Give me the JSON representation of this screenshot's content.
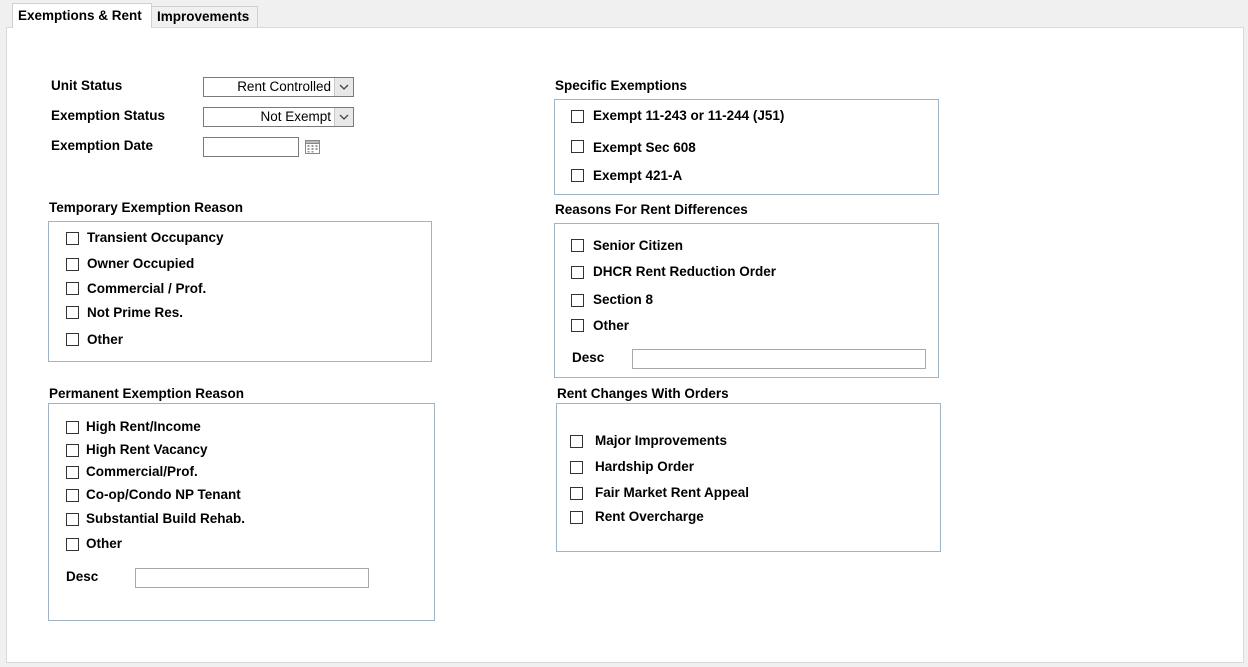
{
  "tabs": [
    {
      "label": "Exemptions & Rent",
      "active": true
    },
    {
      "label": "Improvements",
      "active": false
    }
  ],
  "fields": {
    "unit_status": {
      "label": "Unit Status",
      "value": "Rent Controlled"
    },
    "exemption_status": {
      "label": "Exemption Status",
      "value": "Not Exempt"
    },
    "exemption_date": {
      "label": "Exemption Date",
      "value": ""
    }
  },
  "temporary_exemption": {
    "title": "Temporary Exemption Reason",
    "items": [
      "Transient Occupancy",
      "Owner Occupied",
      "Commercial / Prof.",
      "Not Prime Res.",
      "Other"
    ]
  },
  "permanent_exemption": {
    "title": "Permanent Exemption Reason",
    "items": [
      "High Rent/Income",
      "High Rent Vacancy",
      "Commercial/Prof.",
      "Co-op/Condo NP Tenant",
      "Substantial Build Rehab.",
      "Other"
    ],
    "desc_label": "Desc",
    "desc_value": ""
  },
  "specific_exemptions": {
    "title": "Specific Exemptions",
    "items": [
      "Exempt 11-243 or 11-244 (J51)",
      "Exempt Sec 608",
      "Exempt 421-A"
    ]
  },
  "rent_differences": {
    "title": "Reasons For Rent Differences",
    "items": [
      "Senior Citizen",
      "DHCR Rent Reduction Order",
      "Section 8",
      "Other"
    ],
    "desc_label": "Desc",
    "desc_value": ""
  },
  "rent_changes": {
    "title": "Rent Changes With Orders",
    "items": [
      "Major Improvements",
      "Hardship Order",
      "Fair Market Rent Appeal",
      "Rent Overcharge"
    ]
  },
  "colors": {
    "group_border": "#9fb4c7",
    "background": "#f0f0f0",
    "panel": "#ffffff"
  }
}
